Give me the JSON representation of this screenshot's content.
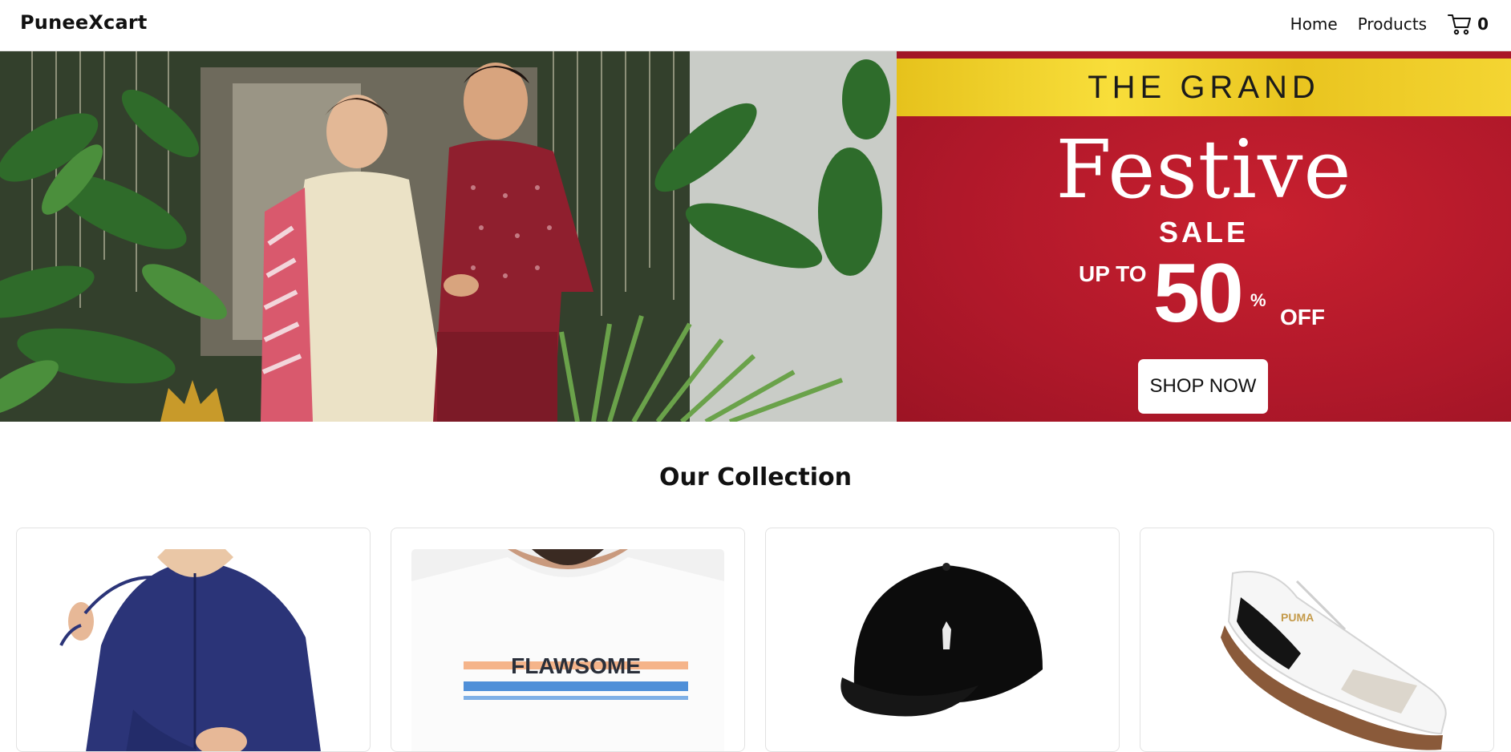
{
  "navbar": {
    "brand": "PuneeXcart",
    "links": [
      "Home",
      "Products"
    ],
    "cart_count": "0"
  },
  "hero": {
    "banner_title": "THE GRAND",
    "banner_headline": "Festive",
    "banner_subhead": "SALE",
    "discount_prefix": "UP TO",
    "discount_value": "50",
    "discount_symbol": "%",
    "discount_suffix": "OFF",
    "cta_label": "SHOP NOW"
  },
  "collection": {
    "title": "Our Collection",
    "products": [
      {
        "name": "navy zip hoodie",
        "icon": "hoodie-image"
      },
      {
        "name": "white graphic t-shirt",
        "print": "FLAWSOME",
        "icon": "tshirt-image"
      },
      {
        "name": "black baseball cap",
        "icon": "cap-image"
      },
      {
        "name": "white sneaker",
        "brand_mark": "PUMA",
        "icon": "sneaker-image"
      }
    ]
  },
  "colors": {
    "sale_red": "#b0182a",
    "gold": "#f0cf2a",
    "hoodie_navy": "#2b3478",
    "stripe_peach": "#f5b48a",
    "stripe_blue": "#4f8fd8"
  }
}
